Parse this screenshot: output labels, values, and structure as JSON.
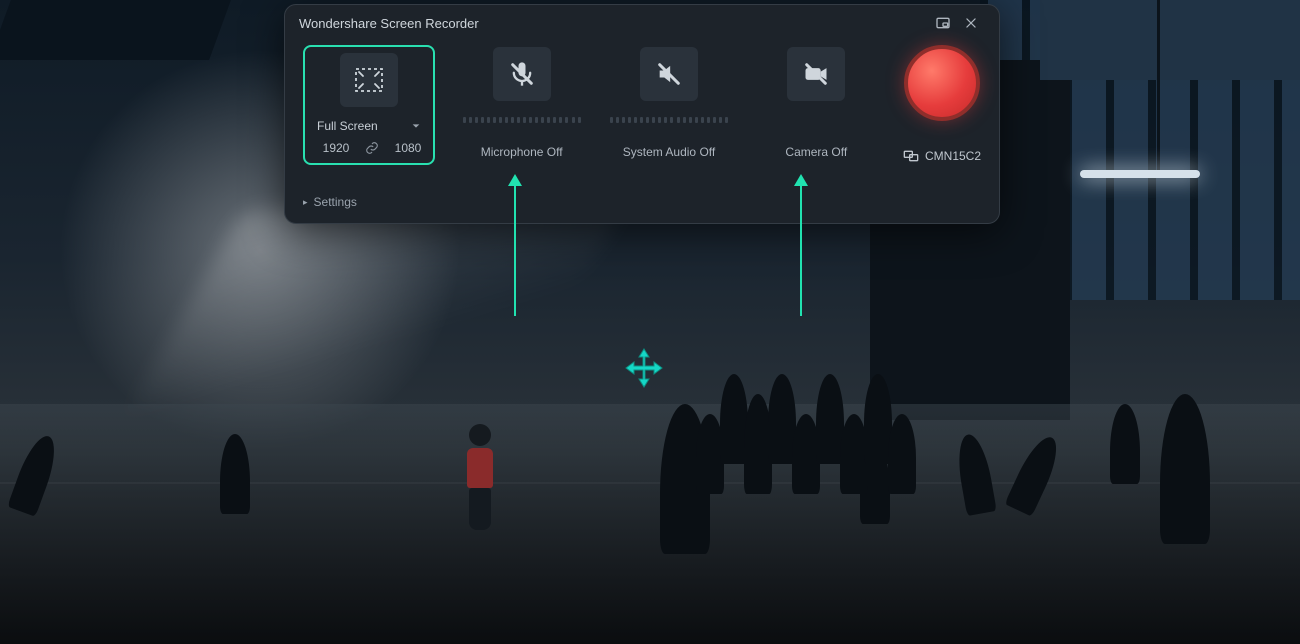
{
  "app": {
    "title": "Wondershare Screen Recorder"
  },
  "screen": {
    "mode_label": "Full Screen",
    "width": "1920",
    "height": "1080"
  },
  "mic": {
    "label": "Microphone Off"
  },
  "sysaudio": {
    "label": "System Audio Off"
  },
  "camera": {
    "label": "Camera Off"
  },
  "record": {
    "monitor_name": "CMN15C2"
  },
  "settings": {
    "label": "Settings"
  }
}
